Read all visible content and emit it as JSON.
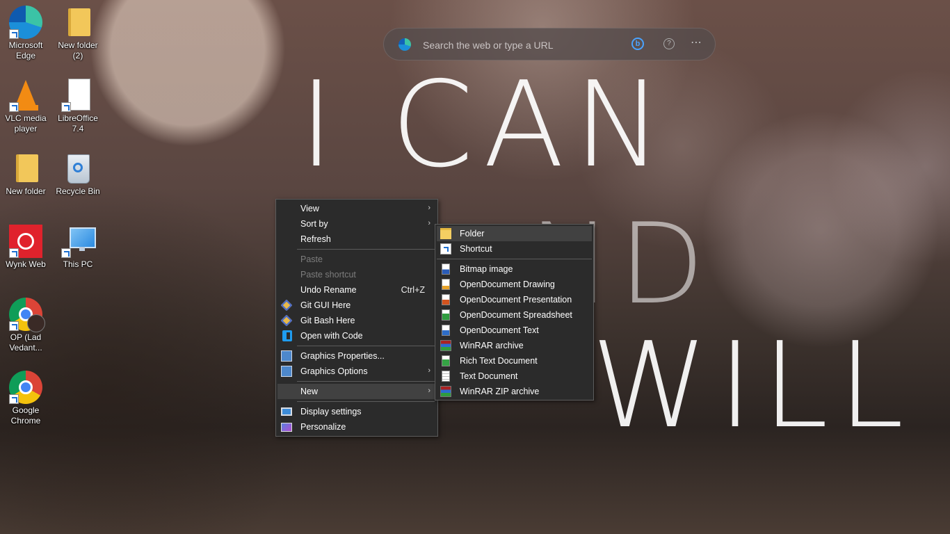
{
  "wallpaper": {
    "line1": "I CAN",
    "line2": "ND",
    "line3": "WILL"
  },
  "desktop_icons": [
    {
      "label": "Microsoft Edge",
      "icon": "edge-icon"
    },
    {
      "label": "New folder (2)",
      "icon": "folder-icon"
    },
    {
      "label": "VLC media player",
      "icon": "vlc-icon"
    },
    {
      "label": "LibreOffice 7.4",
      "icon": "libreoffice-icon"
    },
    {
      "label": "New folder",
      "icon": "folder-icon"
    },
    {
      "label": "Recycle Bin",
      "icon": "recycle-bin-icon"
    },
    {
      "label": "Wynk Web",
      "icon": "wynk-icon"
    },
    {
      "label": "This PC",
      "icon": "computer-icon"
    },
    {
      "label": "OP (Lad Vedant...",
      "icon": "chrome-profile-icon"
    },
    {
      "label": "Google Chrome",
      "icon": "chrome-icon"
    }
  ],
  "search": {
    "placeholder": "Search the web or type a URL",
    "bing": "b",
    "help": "?",
    "more": "⋯"
  },
  "context_menu": {
    "view": "View",
    "sort_by": "Sort by",
    "refresh": "Refresh",
    "paste": "Paste",
    "paste_shortcut": "Paste shortcut",
    "undo_rename": "Undo Rename",
    "undo_shortcut": "Ctrl+Z",
    "git_gui": "Git GUI Here",
    "git_bash": "Git Bash Here",
    "open_code": "Open with Code",
    "graphics_properties": "Graphics Properties...",
    "graphics_options": "Graphics Options",
    "new": "New",
    "display_settings": "Display settings",
    "personalize": "Personalize"
  },
  "new_submenu": {
    "folder": "Folder",
    "shortcut": "Shortcut",
    "bitmap": "Bitmap image",
    "odg": "OpenDocument Drawing",
    "odp": "OpenDocument Presentation",
    "ods": "OpenDocument Spreadsheet",
    "odt": "OpenDocument Text",
    "rar": "WinRAR archive",
    "rtf": "Rich Text Document",
    "txt": "Text Document",
    "zip": "WinRAR ZIP archive"
  },
  "chevron": "›"
}
